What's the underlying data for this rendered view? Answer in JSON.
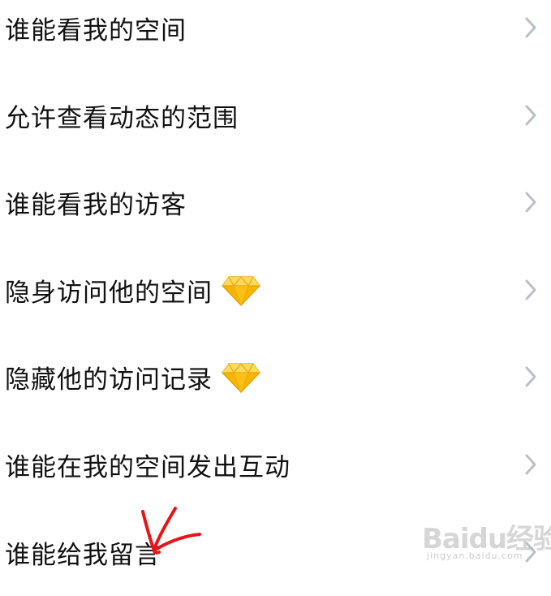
{
  "settings_list": {
    "items": [
      {
        "label": "谁能看我的空间",
        "vip": false
      },
      {
        "label": "允许查看动态的范围",
        "vip": false
      },
      {
        "label": "谁能看我的访客",
        "vip": false
      },
      {
        "label": "隐身访问他的空间",
        "vip": true
      },
      {
        "label": "隐藏他的访问记录",
        "vip": true
      },
      {
        "label": "谁能在我的空间发出互动",
        "vip": false
      },
      {
        "label": "谁能给我留言",
        "vip": false
      }
    ]
  },
  "icons": {
    "chevron": "chevron-right-icon",
    "vip_badge": "diamond-icon",
    "annotation": "red-arrow-annotation"
  },
  "colors": {
    "text": "#111111",
    "chevron": "#b9c0c8",
    "diamond_main": "#f7b500",
    "diamond_light": "#ffd95c",
    "annotation": "#e8141b"
  },
  "watermark": {
    "logo": "Baidu经验",
    "url": "jingyan.baidu.com"
  }
}
